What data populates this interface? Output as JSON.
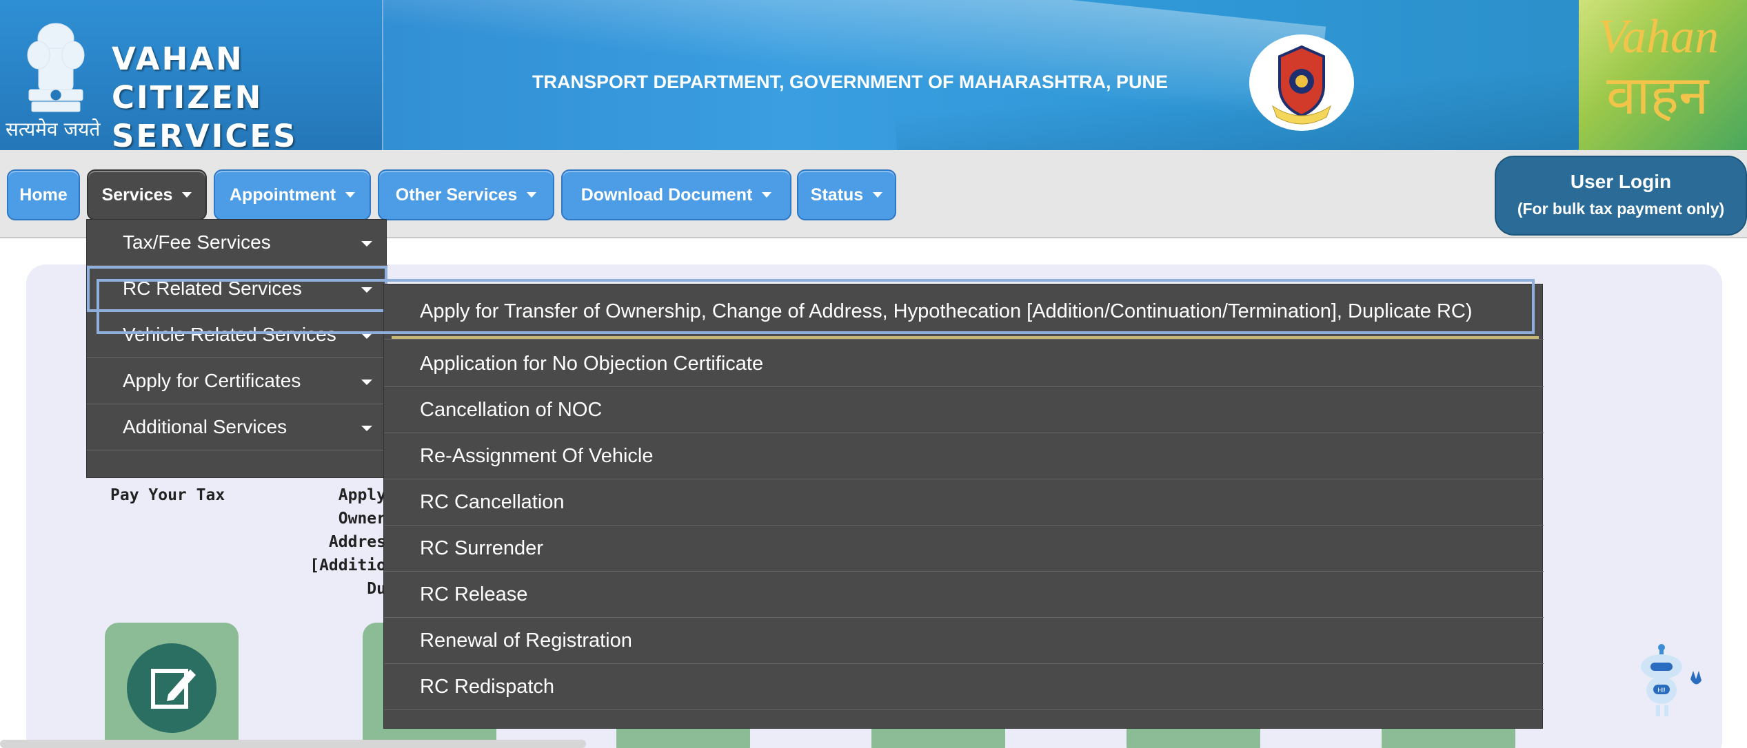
{
  "header": {
    "site_title_line1": "VAHAN CITIZEN",
    "site_title_line2": "SERVICES",
    "emblem_motto": "सत्यमेव जयते",
    "department": "TRANSPORT DEPARTMENT, GOVERNMENT OF MAHARASHTRA, PUNE",
    "brand_en": "Vahan",
    "brand_hi": "वाहन"
  },
  "nav": {
    "items": [
      {
        "label": "Home",
        "has_caret": false
      },
      {
        "label": "Services",
        "has_caret": true,
        "active": true
      },
      {
        "label": "Appointment",
        "has_caret": true
      },
      {
        "label": "Other Services",
        "has_caret": true
      },
      {
        "label": "Download Document",
        "has_caret": true
      },
      {
        "label": "Status",
        "has_caret": true
      }
    ],
    "login_line1": "User Login",
    "login_line2": "(For bulk tax payment only)"
  },
  "services_menu": {
    "items": [
      "Tax/Fee Services",
      "RC Related Services",
      "Vehicle Related Services",
      "Apply for Certificates",
      "Additional Services"
    ],
    "highlighted": "RC Related Services"
  },
  "rc_submenu": {
    "items": [
      "Apply for Transfer of Ownership, Change of Address, Hypothecation [Addition/Continuation/Termination], Duplicate RC)",
      "Application for No Objection Certificate",
      "Cancellation of NOC",
      "Re-Assignment Of Vehicle",
      "RC Cancellation",
      "RC Surrender",
      "RC Release",
      "Renewal of Registration",
      "RC Redispatch"
    ]
  },
  "tiles": {
    "pay_tax_label": "Pay Your Tax",
    "partial_label_lines": [
      "Apply",
      "Owner",
      "Addres",
      "[Additio",
      "Du"
    ]
  },
  "colors": {
    "nav_button": "#4d9de6",
    "menu_bg": "#4a4a4a",
    "highlight_outline": "#8fb0dd",
    "login_button": "#2a6c97"
  }
}
